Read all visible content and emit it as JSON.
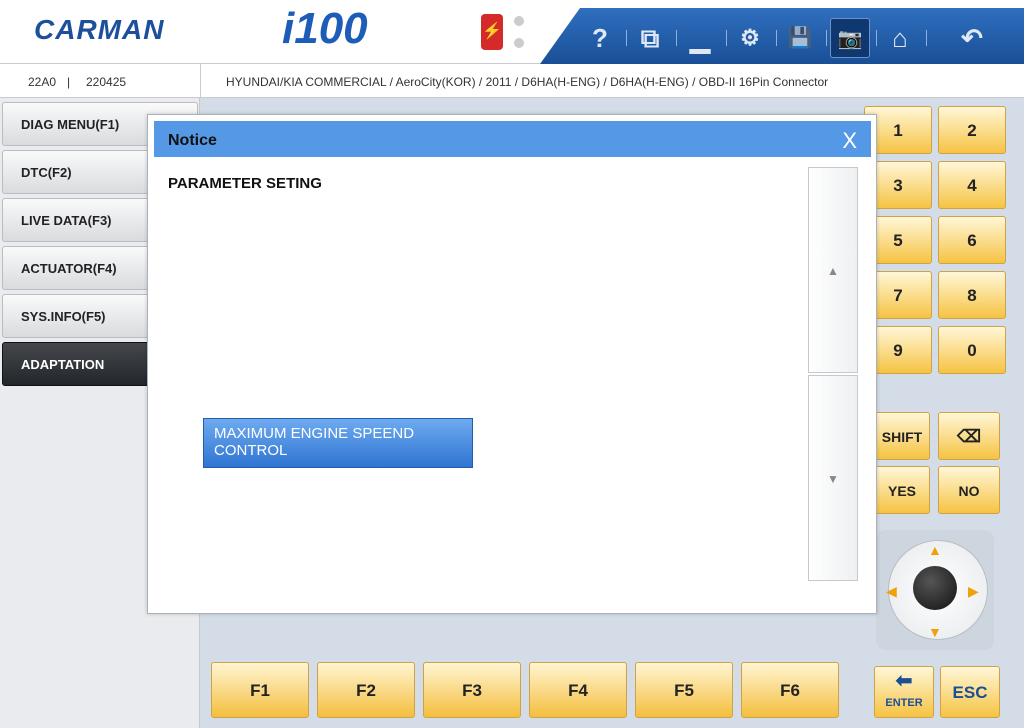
{
  "app": {
    "logo": "CARMAN",
    "product": "i100",
    "usb_icon": "usb-icon"
  },
  "toolbar": {
    "items": [
      {
        "name": "help",
        "icon": "help-icon",
        "glyph": "?"
      },
      {
        "name": "window",
        "icon": "window-icon",
        "glyph": "⧉"
      },
      {
        "name": "minimize",
        "icon": "minimize-icon",
        "glyph": "▁"
      },
      {
        "name": "settings",
        "icon": "gear-icon",
        "glyph": "⚙"
      },
      {
        "name": "save",
        "icon": "save-icon",
        "glyph": "💾"
      },
      {
        "name": "screenshot",
        "icon": "camera-icon",
        "glyph": "📷"
      },
      {
        "name": "home",
        "icon": "home-icon",
        "glyph": "⌂"
      },
      {
        "name": "back",
        "icon": "back-icon",
        "glyph": "↶"
      }
    ]
  },
  "pathbar": {
    "code": "22A0",
    "separator": "|",
    "version": "220425",
    "path": "HYUNDAI/KIA COMMERCIAL / AeroCity(KOR) / 2011 / D6HA(H-ENG) / D6HA(H-ENG) / OBD-II 16Pin Connector"
  },
  "sidebar": {
    "items": [
      {
        "label": "DIAG MENU(F1)",
        "active": false
      },
      {
        "label": "DTC(F2)",
        "active": false
      },
      {
        "label": "LIVE DATA(F3)",
        "active": false
      },
      {
        "label": "ACTUATOR(F4)",
        "active": false
      },
      {
        "label": "SYS.INFO(F5)",
        "active": false
      },
      {
        "label": "ADAPTATION",
        "active": true
      }
    ]
  },
  "dialog": {
    "title": "Notice",
    "close": "X",
    "message": "PARAMETER SETING",
    "option": "MAXIMUM ENGINE SPEEND CONTROL",
    "scroll_up": "▲",
    "scroll_down": "▼"
  },
  "keypad": {
    "digits": [
      "1",
      "2",
      "3",
      "4",
      "5",
      "6",
      "7",
      "8",
      "9",
      "0"
    ],
    "shift": "SHIFT",
    "backspace": "⌫",
    "yes": "YES",
    "no": "NO",
    "enter": "ENTER",
    "esc": "ESC"
  },
  "function_keys": [
    "F1",
    "F2",
    "F3",
    "F4",
    "F5",
    "F6"
  ],
  "colors": {
    "accent": "#2f75d2",
    "key_yellow": "#f6c343",
    "header_blue": "#5599e6"
  }
}
